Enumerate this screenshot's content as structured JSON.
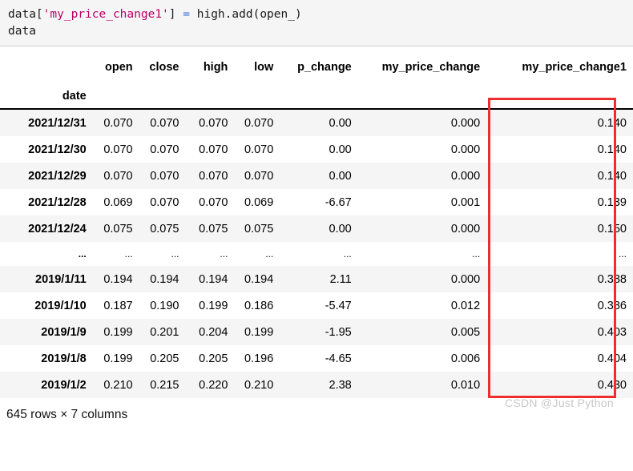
{
  "notebook": {
    "code_cell": {
      "lines": [
        {
          "tokens": [
            {
              "t": "data",
              "k": "plain"
            },
            {
              "t": "[",
              "k": "bracket"
            },
            {
              "t": "'my_price_change1'",
              "k": "str"
            },
            {
              "t": "]",
              "k": "bracket"
            },
            {
              "t": " ",
              "k": "plain"
            },
            {
              "t": "=",
              "k": "op"
            },
            {
              "t": " high",
              "k": "plain"
            },
            {
              "t": ".",
              "k": "plain"
            },
            {
              "t": "add",
              "k": "plain"
            },
            {
              "t": "(",
              "k": "paren"
            },
            {
              "t": "open_",
              "k": "plain"
            },
            {
              "t": ")",
              "k": "paren"
            }
          ],
          "plain": "data['my_price_change1'] = high.add(open_)"
        },
        {
          "tokens": [
            {
              "t": "data",
              "k": "plain"
            }
          ],
          "plain": "data"
        }
      ]
    }
  },
  "table": {
    "index_name": "date",
    "columns": [
      "open",
      "close",
      "high",
      "low",
      "p_change",
      "my_price_change",
      "my_price_change1"
    ],
    "ellipsis_glyph": "...",
    "rows": [
      {
        "index": "2021/12/31",
        "cells": [
          "0.070",
          "0.070",
          "0.070",
          "0.070",
          "0.00",
          "0.000",
          "0.140"
        ]
      },
      {
        "index": "2021/12/30",
        "cells": [
          "0.070",
          "0.070",
          "0.070",
          "0.070",
          "0.00",
          "0.000",
          "0.140"
        ]
      },
      {
        "index": "2021/12/29",
        "cells": [
          "0.070",
          "0.070",
          "0.070",
          "0.070",
          "0.00",
          "0.000",
          "0.140"
        ]
      },
      {
        "index": "2021/12/28",
        "cells": [
          "0.069",
          "0.070",
          "0.070",
          "0.069",
          "-6.67",
          "0.001",
          "0.139"
        ]
      },
      {
        "index": "2021/12/24",
        "cells": [
          "0.075",
          "0.075",
          "0.075",
          "0.075",
          "0.00",
          "0.000",
          "0.150"
        ]
      },
      {
        "index": "...",
        "cells": [
          "...",
          "...",
          "...",
          "...",
          "...",
          "...",
          "..."
        ],
        "is_ellipsis": true
      },
      {
        "index": "2019/1/11",
        "cells": [
          "0.194",
          "0.194",
          "0.194",
          "0.194",
          "2.11",
          "0.000",
          "0.388"
        ]
      },
      {
        "index": "2019/1/10",
        "cells": [
          "0.187",
          "0.190",
          "0.199",
          "0.186",
          "-5.47",
          "0.012",
          "0.386"
        ]
      },
      {
        "index": "2019/1/9",
        "cells": [
          "0.199",
          "0.201",
          "0.204",
          "0.199",
          "-1.95",
          "0.005",
          "0.403"
        ]
      },
      {
        "index": "2019/1/8",
        "cells": [
          "0.199",
          "0.205",
          "0.205",
          "0.196",
          "-4.65",
          "0.006",
          "0.404"
        ]
      },
      {
        "index": "2019/1/2",
        "cells": [
          "0.210",
          "0.215",
          "0.220",
          "0.210",
          "2.38",
          "0.010",
          "0.430"
        ]
      }
    ],
    "shape_text": "645 rows × 7 columns"
  },
  "annotation": {
    "highlight_color": "#f02d2d",
    "highlighted_column": "my_price_change1"
  },
  "watermark": {
    "text": "CSDN @Just Python"
  }
}
